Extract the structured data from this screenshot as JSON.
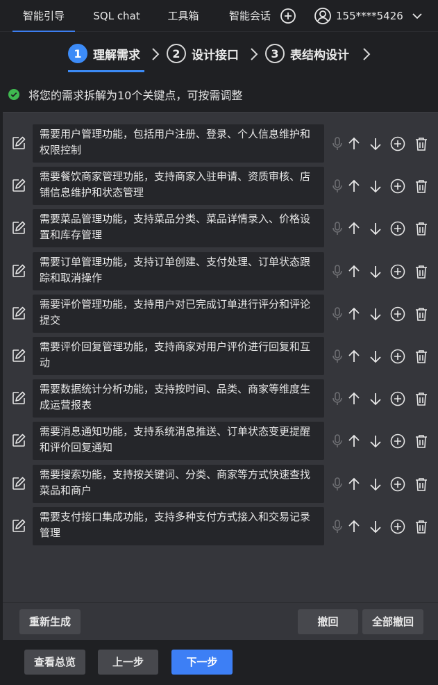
{
  "nav": {
    "tabs": [
      "智能引导",
      "SQL chat",
      "工具箱",
      "智能会话"
    ],
    "active_tab": 0,
    "user_phone": "155****5426"
  },
  "steps": {
    "items": [
      {
        "num": "1",
        "label": "理解需求"
      },
      {
        "num": "2",
        "label": "设计接口"
      },
      {
        "num": "3",
        "label": "表结构设计"
      }
    ],
    "active": 0
  },
  "status": {
    "text": "将您的需求拆解为10个关键点，可按需调整"
  },
  "requirements": [
    "需要用户管理功能，包括用户注册、登录、个人信息维护和权限控制",
    "需要餐饮商家管理功能，支持商家入驻申请、资质审核、店铺信息维护和状态管理",
    "需要菜品管理功能，支持菜品分类、菜品详情录入、价格设置和库存管理",
    "需要订单管理功能，支持订单创建、支付处理、订单状态跟踪和取消操作",
    "需要评价管理功能，支持用户对已完成订单进行评分和评论提交",
    "需要评价回复管理功能，支持商家对用户评价进行回复和互动",
    "需要数据统计分析功能，支持按时间、品类、商家等维度生成运营报表",
    "需要消息通知功能，支持系统消息推送、订单状态变更提醒和评价回复通知",
    "需要搜索功能，支持按关键词、分类、商家等方式快速查找菜品和商户",
    "需要支付接口集成功能，支持多种支付方式接入和交易记录管理"
  ],
  "actions": {
    "regenerate": "重新生成",
    "undo": "撤回",
    "undo_all": "全部撤回"
  },
  "footer": {
    "overview": "查看总览",
    "prev": "上一步",
    "next": "下一步"
  },
  "colors": {
    "accent": "#3c8bf7",
    "primary_button": "#3d7ff5",
    "success": "#3fb950"
  }
}
